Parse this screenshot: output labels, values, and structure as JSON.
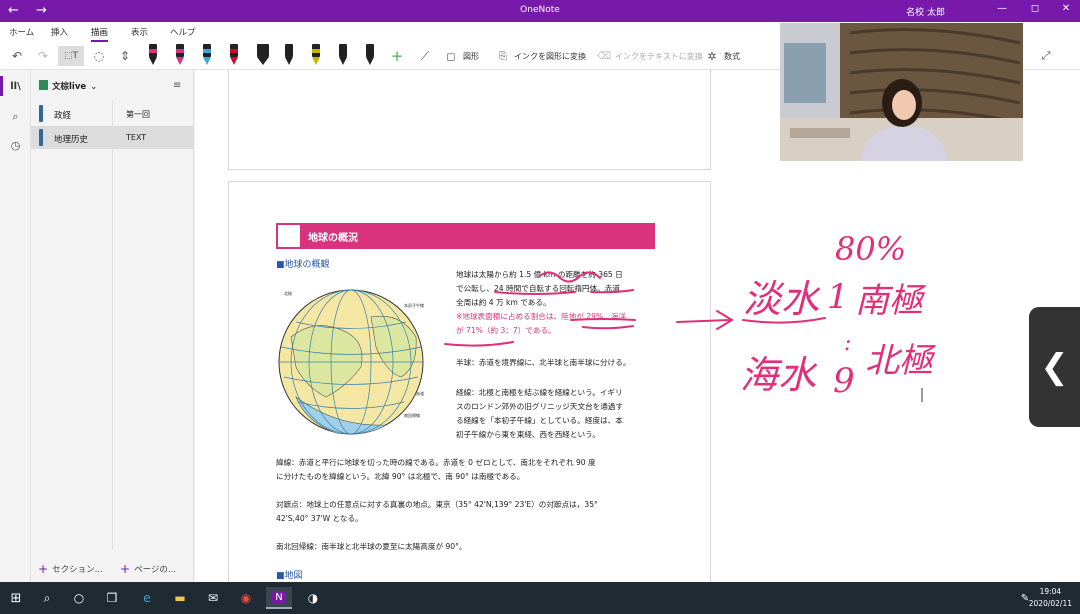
{
  "titlebar": {
    "title": "OneNote",
    "user": "名校 太郎",
    "back": "←",
    "forward": "→",
    "minimize": "—",
    "maximize": "◻",
    "close": "✕"
  },
  "ribbon": {
    "tabs": [
      "ホーム",
      "挿入",
      "描画",
      "表示",
      "ヘルプ"
    ],
    "active_tab": "描画"
  },
  "toolbar": {
    "shape_label": "図形",
    "ink_to_shape_label": "インクを図形に変換",
    "ink_to_text_label": "インクをテキストに変換",
    "math_label": "数式",
    "pen_colors": [
      "#d8337c",
      "#d8337c",
      "#3fa6d8",
      "#c8102e",
      "#222222",
      "#222222",
      "#c3b600",
      "#222222",
      "#222222"
    ],
    "accent": "#7719aa"
  },
  "nav": {
    "notebook": "文棕live",
    "sections": [
      {
        "label": "政経",
        "color": "#2d6a9a"
      },
      {
        "label": "地理历史",
        "color": "#2d6a9a"
      }
    ],
    "pages": [
      "第一回",
      "TEXT"
    ],
    "add_section": "セクション...",
    "add_page": "ページの..."
  },
  "doc": {
    "header": "地球の概況",
    "sub1": "■地球の概観",
    "para1": "地球は太陽から約 1.5 億 km の距離を約 365 日\nで公転し、24 時間で自転する回転楕円体。赤道\n全周は約 4 万 km である。",
    "para1_pink": "※地球表面積に占める割合は、陸地が 29%、海洋\nが 71%（約 3：7）である。",
    "para2": "半球：赤道を境界線に、北半球と南半球に分ける。",
    "para3": "経線：北極と南極を結ぶ線を経線という。イギリ\nスのロンドン郊外の旧グリニッジ天文台を通過す\nる経線を「本初子午線」としている。経度は、本\n初子午線から東を東経、西を西経という。",
    "para4": "緯線：赤道と平行に地球を切った時の線である。赤道を 0 ゼロとして、南北をそれぞれ 90 度\nに分けたものを緯線という。北緯 90° は北極で、南 90° は南極である。",
    "para5": "対蹠点：地球上の任意点に対する真裏の地点。東京（35° 42'N,139° 23'E）の対蹠点は，35°\n42'S,40° 37'W となる。",
    "para6": "南北回帰線：南半球と北半球の夏至に太陽高度が 90°。",
    "sub2": "■地図",
    "globe_labels": [
      "北極",
      "赤道",
      "本初子午線",
      "南回帰線"
    ]
  },
  "ink": {
    "color": "#e0307a",
    "text_80": "80%",
    "tansui": "淡水",
    "kaisui": "海水",
    "one": "1",
    "nine": "9",
    "nankyoku": "南極",
    "hokkyoku": "北極",
    "ratio_sep": ":"
  },
  "side_tab_glyph": "❮",
  "taskbar": {
    "time": "19:04",
    "date": "2020/02/11"
  }
}
